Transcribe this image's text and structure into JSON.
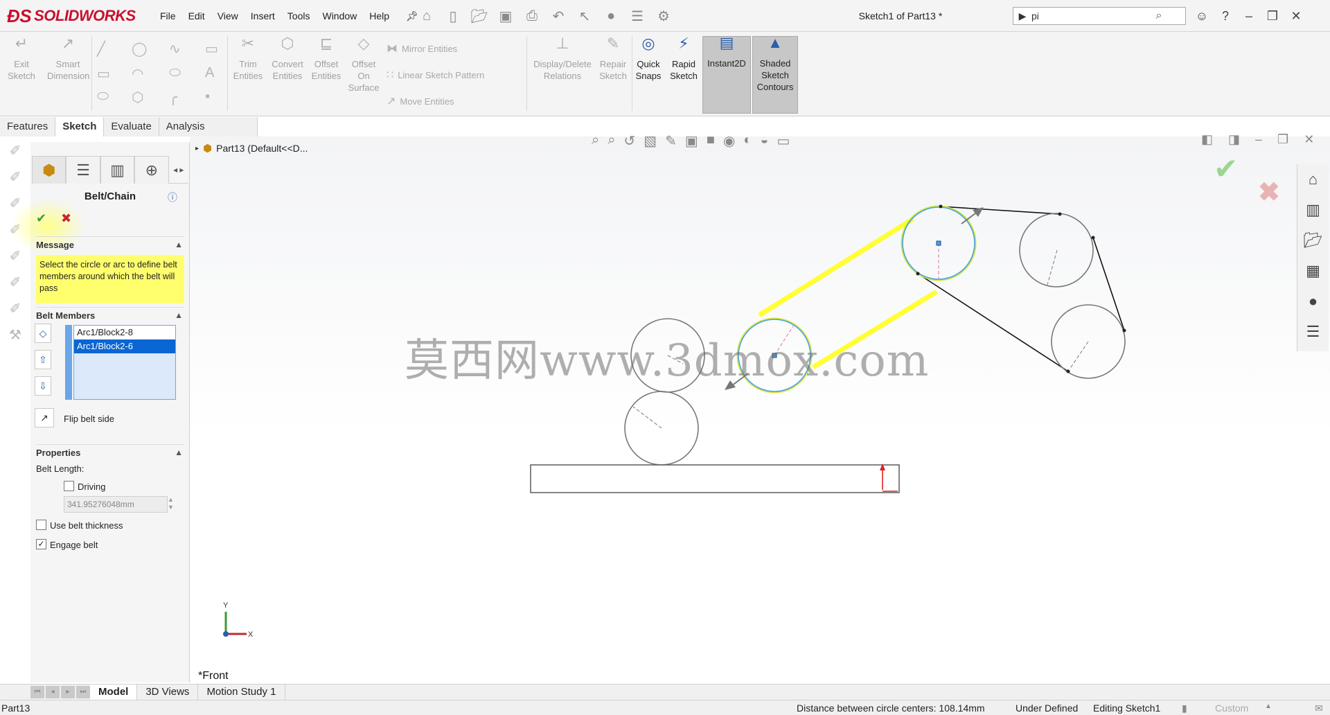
{
  "app": {
    "logo_text": "SOLIDWORKS",
    "document_title": "Sketch1 of Part13 *"
  },
  "menu": [
    "File",
    "Edit",
    "View",
    "Insert",
    "Tools",
    "Window",
    "Help"
  ],
  "search": {
    "value": "pi"
  },
  "commands": {
    "exit_sketch": "Exit Sketch",
    "smart_dimension": "Smart Dimension",
    "trim_entities": "Trim Entities",
    "convert_entities": "Convert Entities",
    "offset_entities": "Offset Entities",
    "offset_on_surface": "Offset On Surface",
    "mirror_entities": "Mirror Entities",
    "linear_sketch_pattern": "Linear Sketch Pattern",
    "move_entities": "Move Entities",
    "display_delete_relations": "Display/Delete Relations",
    "repair_sketch": "Repair Sketch",
    "quick_snaps": "Quick Snaps",
    "rapid_sketch": "Rapid Sketch",
    "instant2d": "Instant2D",
    "shaded_sketch_contours": "Shaded Sketch Contours"
  },
  "tabs": [
    "Features",
    "Sketch",
    "Evaluate",
    "Analysis Preparation"
  ],
  "active_tab": "Sketch",
  "property_manager": {
    "title": "Belt/Chain",
    "message_section": "Message",
    "message_text": "Select the circle or arc to define belt members around which the belt will pass",
    "belt_members_section": "Belt Members",
    "belt_members": [
      "Arc1/Block2-8",
      "Arc1/Block2-6"
    ],
    "selected_member": "Arc1/Block2-6",
    "flip_belt_side": "Flip belt side",
    "properties_section": "Properties",
    "belt_length_label": "Belt Length:",
    "driving_label": "Driving",
    "driving_checked": false,
    "belt_length_value": "341.95276048mm",
    "use_belt_thickness_label": "Use belt thickness",
    "use_belt_thickness_checked": false,
    "engage_belt_label": "Engage belt",
    "engage_belt_checked": true
  },
  "viewport": {
    "tree_item": "Part13  (Default<<D...",
    "watermark": "莫西网www.3dmox.com",
    "view_name": "*Front",
    "triad_x": "X",
    "triad_y": "Y"
  },
  "bottom_tabs": [
    "Model",
    "3D Views",
    "Motion Study 1"
  ],
  "active_bottom_tab": "Model",
  "status": {
    "part": "Part13",
    "distance": "Distance between circle centers: 108.14mm",
    "definition": "Under Defined",
    "editing": "Editing Sketch1",
    "units": "Custom"
  },
  "colors": {
    "belt_highlight": "#ffff33",
    "selected_circle": "#4aa0e8",
    "message_bg": "#ffff6e",
    "list_selection": "#0a66d2"
  }
}
